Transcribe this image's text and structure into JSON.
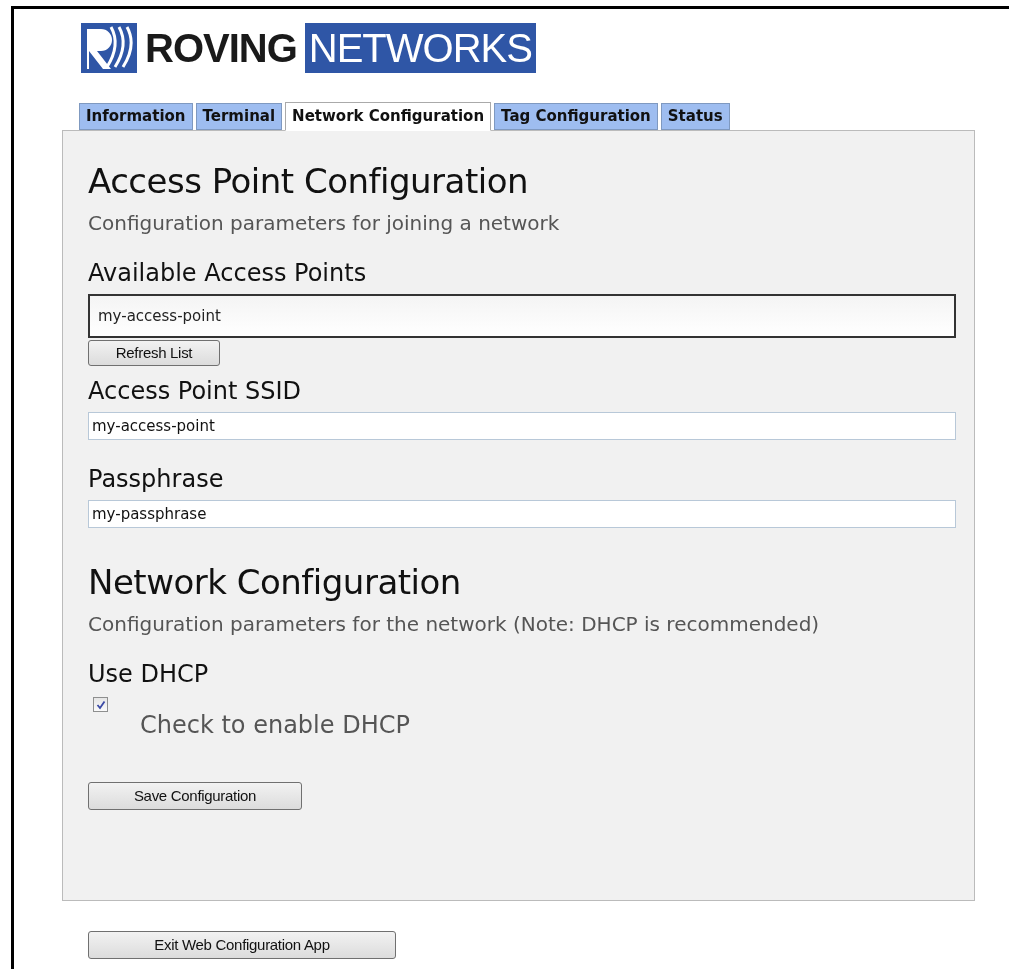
{
  "logo": {
    "word_1": "ROVING",
    "word_2": "NETWORKS"
  },
  "tabs": [
    {
      "label": "Information",
      "selected": false
    },
    {
      "label": "Terminal",
      "selected": false
    },
    {
      "label": "Network Configuration",
      "selected": true
    },
    {
      "label": "Tag Configuration",
      "selected": false
    },
    {
      "label": "Status",
      "selected": false
    }
  ],
  "sections": [
    {
      "title": "Access Point Configuration",
      "subtitle": "Configuration parameters for joining a network",
      "fields": [
        {
          "kind": "list",
          "label": "Available Access Points",
          "value": "my-access-point",
          "button": "Refresh List"
        },
        {
          "kind": "text",
          "label": "Access Point SSID",
          "value": "my-access-point"
        },
        {
          "kind": "text",
          "label": "Passphrase",
          "value": "my-passphrase"
        }
      ]
    },
    {
      "title": "Network Configuration",
      "subtitle": "Configuration parameters for the network (Note: DHCP is recommended)",
      "fields": [
        {
          "kind": "checkbox",
          "label": "Use DHCP",
          "checked": true,
          "caption": "Check to enable DHCP"
        }
      ]
    }
  ],
  "save_button": "Save Configuration",
  "exit_button": "Exit Web Configuration App"
}
